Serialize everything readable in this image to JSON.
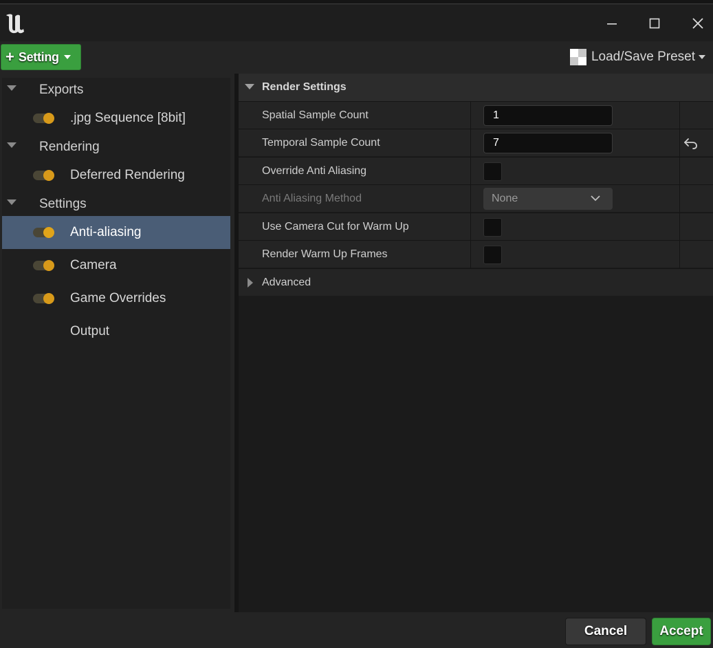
{
  "window": {
    "logo": "unreal-engine-logo",
    "controls": [
      "minimize-icon",
      "maximize-icon",
      "close-icon"
    ]
  },
  "toolbar": {
    "add_setting_label": "Setting",
    "preset_label": "Load/Save Preset"
  },
  "tree": {
    "groups": [
      {
        "label": "Exports",
        "items": [
          {
            "label": ".jpg Sequence [8bit]",
            "enabled": true
          }
        ]
      },
      {
        "label": "Rendering",
        "items": [
          {
            "label": "Deferred Rendering",
            "enabled": true
          }
        ]
      },
      {
        "label": "Settings",
        "items": [
          {
            "label": "Anti-aliasing",
            "enabled": true,
            "selected": true
          },
          {
            "label": "Camera",
            "enabled": true
          },
          {
            "label": "Game Overrides",
            "enabled": true
          },
          {
            "label": "Output",
            "enabled": null
          }
        ]
      }
    ]
  },
  "details": {
    "category": "Render Settings",
    "properties": [
      {
        "name": "Spatial Sample Count",
        "type": "number",
        "value": "1"
      },
      {
        "name": "Temporal Sample Count",
        "type": "number",
        "value": "7",
        "modified": true
      },
      {
        "name": "Override Anti Aliasing",
        "type": "checkbox",
        "checked": false
      },
      {
        "name": "Anti Aliasing Method",
        "type": "combo",
        "value": "None",
        "disabled": true
      },
      {
        "name": "Use Camera Cut for Warm Up",
        "type": "checkbox",
        "checked": false
      },
      {
        "name": "Render Warm Up Frames",
        "type": "checkbox",
        "checked": false
      }
    ],
    "advanced_label": "Advanced"
  },
  "footer": {
    "cancel_label": "Cancel",
    "accept_label": "Accept"
  },
  "colors": {
    "accent_green": "#3a9f3f",
    "toggle_on": "#d89a1a",
    "selection": "#4a5d76"
  }
}
